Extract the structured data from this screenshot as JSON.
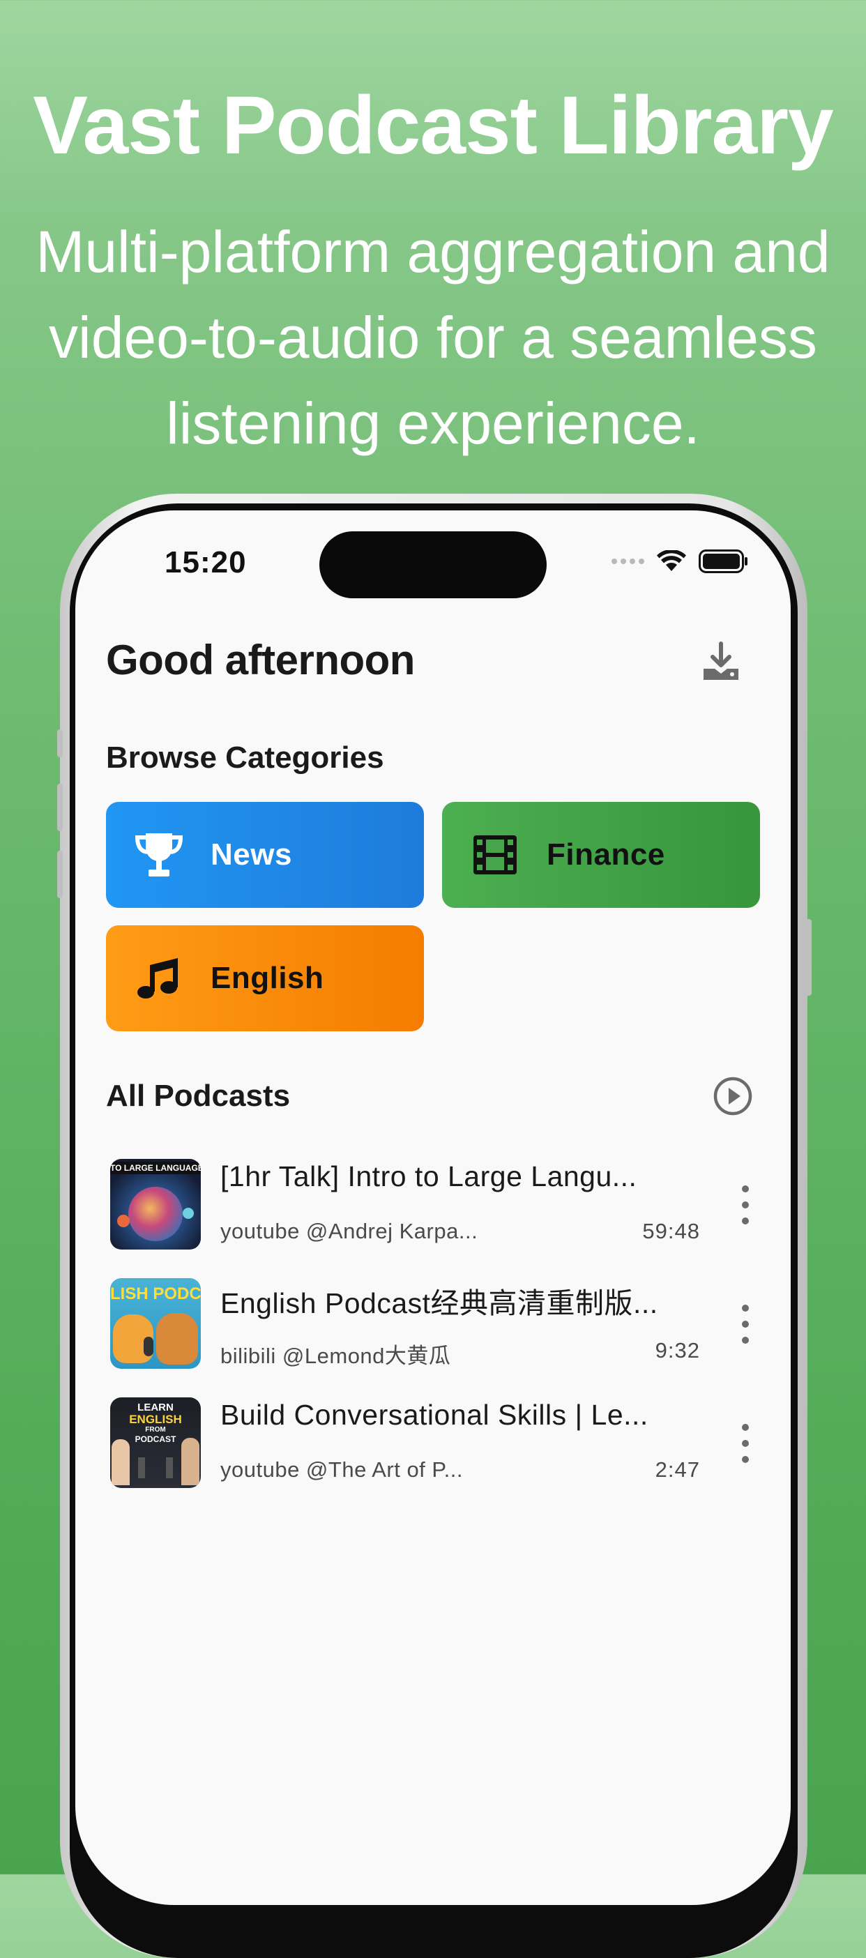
{
  "hero": {
    "title": "Vast Podcast Library",
    "subtitle": "Multi-platform aggregation and video-to-audio for a seamless listening experience."
  },
  "status_bar": {
    "time": "15:20"
  },
  "header": {
    "greeting": "Good afternoon",
    "download_icon": "download-icon"
  },
  "categories": {
    "title": "Browse Categories",
    "items": [
      {
        "label": "News",
        "icon": "trophy-icon",
        "color": "#2196F3"
      },
      {
        "label": "Finance",
        "icon": "film-icon",
        "color": "#4CAF50"
      },
      {
        "label": "English",
        "icon": "music-note-icon",
        "color": "#FB8C00"
      }
    ]
  },
  "podcasts": {
    "title": "All Podcasts",
    "play_icon": "play-circle-icon",
    "items": [
      {
        "title": "[1hr Talk] Intro to Large Langu...",
        "source": "youtube @Andrej Karpa...",
        "duration": "59:48",
        "thumb_text": "TO LARGE LANGUAGE MO"
      },
      {
        "title": "English Podcast经典高清重制版...",
        "source": "bilibili @Lemond大黄瓜",
        "duration": "9:32",
        "thumb_text": "LISH PODCA"
      },
      {
        "title": "Build Conversational Skills | Le...",
        "source": "youtube @The Art of P...",
        "duration": "2:47",
        "thumb_text_1": "LEARN",
        "thumb_text_2": "ENGLISH",
        "thumb_text_3": "FROM",
        "thumb_text_4": "PODCAST"
      }
    ]
  }
}
